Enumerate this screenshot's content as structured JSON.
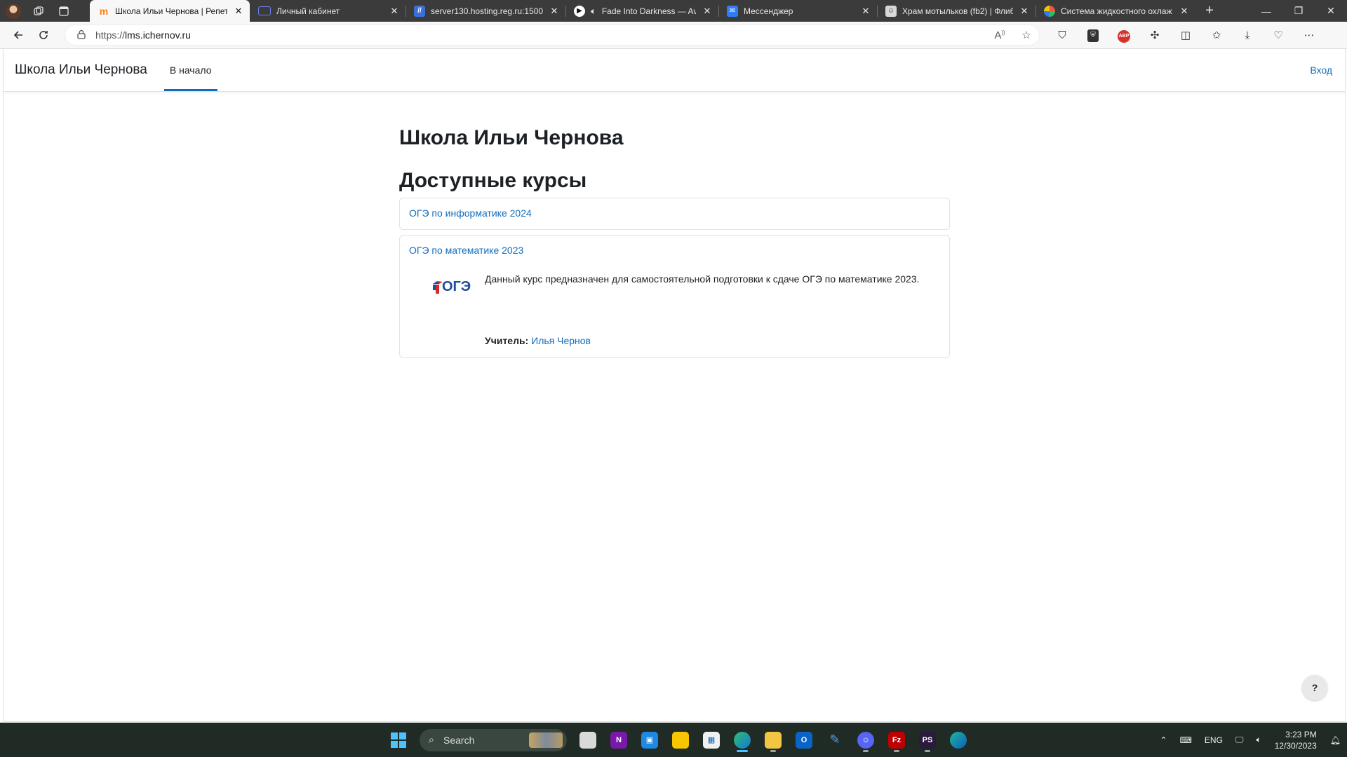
{
  "browser": {
    "tabs": [
      {
        "title": "Школа Ильи Чернова | Репет",
        "favicon": "moodle-favicon",
        "fav_color": "#f98012",
        "fav_glyph": "m",
        "active": true
      },
      {
        "title": "Личный кабинет",
        "favicon": "cabinet-favicon",
        "fav_color": "#3a5bd9",
        "fav_glyph": "",
        "active": false
      },
      {
        "title": "server130.hosting.reg.ru:1500",
        "favicon": "ispmanager-favicon",
        "fav_color": "#3a6fd8",
        "fav_glyph": "//",
        "active": false
      },
      {
        "title": "Fade Into Darkness — Avi",
        "favicon": "media-favicon",
        "fav_color": "#ffffff",
        "fav_glyph": "▶",
        "active": false,
        "audio": true
      },
      {
        "title": "Мессенджер",
        "favicon": "messenger-favicon",
        "fav_color": "#2f7cf6",
        "fav_glyph": "✉",
        "active": false
      },
      {
        "title": "Храм мотыльков (fb2) | Флиб",
        "favicon": "flibusta-favicon",
        "fav_color": "#d8d8d8",
        "fav_glyph": "☺",
        "active": false
      },
      {
        "title": "Система жидкостного охлаж",
        "favicon": "multicolor-favicon",
        "fav_color": "#2dbe60",
        "fav_glyph": "●",
        "active": false
      }
    ],
    "url_prefix": "https://",
    "url_host": "lms.ichernov.ru"
  },
  "page": {
    "brand": "Школа Ильи Чернова",
    "nav_home": "В начало",
    "login": "Вход",
    "site_title": "Школа Ильи Чернова",
    "section_title": "Доступные курсы",
    "courses": [
      {
        "name": "ОГЭ по информатике 2024"
      },
      {
        "name": "ОГЭ по математике 2023",
        "logo_text": "ОГЭ",
        "summary": "Данный курс предназначен для самостоятельной подготовки к сдаче ОГЭ по математике 2023.",
        "teacher_label": "Учитель:",
        "teacher_name": "Илья Чернов"
      }
    ],
    "help_label": "?"
  },
  "taskbar": {
    "search_label": "Search",
    "lang": "ENG",
    "time": "3:23 PM",
    "date": "12/30/2023"
  },
  "colors": {
    "link": "#0f6cbf",
    "accent": "#0f6cbf",
    "text": "#1d2125"
  }
}
